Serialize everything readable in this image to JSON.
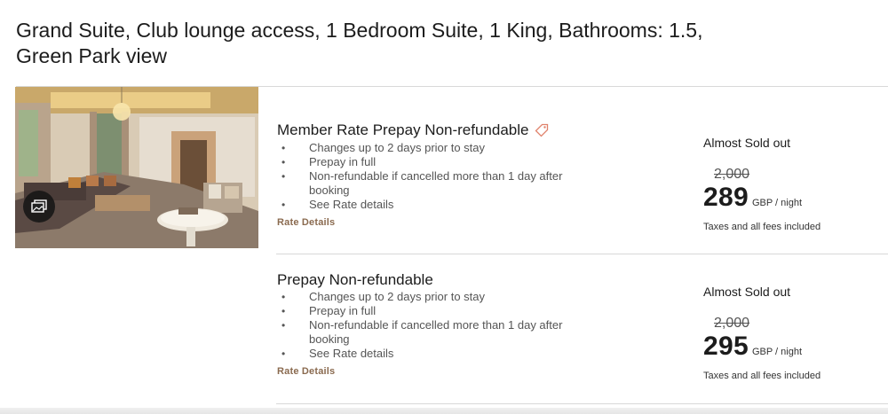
{
  "room": {
    "title": "Grand Suite, Club lounge access, 1 Bedroom Suite, 1 King, Bathrooms: 1.5, Green Park view",
    "gallery_icon": "gallery-icon"
  },
  "rates": [
    {
      "name": "Member Rate Prepay Non-refundable",
      "badge_icon": "tag-icon",
      "features": [
        "Changes up to 2 days prior to stay",
        "Prepay in full",
        "Non-refundable if cancelled more than 1 day after booking",
        "See Rate details"
      ],
      "details_label": "Rate Details",
      "availability": "Almost Sold out",
      "original_price": "2,000",
      "price": "289",
      "price_unit": "GBP / night",
      "price_note": "Taxes and all fees included"
    },
    {
      "name": "Prepay Non-refundable",
      "features": [
        "Changes up to 2 days prior to stay",
        "Prepay in full",
        "Non-refundable if cancelled more than 1 day after booking",
        "See Rate details"
      ],
      "details_label": "Rate Details",
      "availability": "Almost Sold out",
      "original_price": "2,000",
      "price": "295",
      "price_unit": "GBP / night",
      "price_note": "Taxes and all fees included"
    }
  ],
  "colors": {
    "link": "#8a6a4f",
    "tag_icon": "#e0826b",
    "text": "#1c1c1c",
    "muted": "#555555"
  }
}
